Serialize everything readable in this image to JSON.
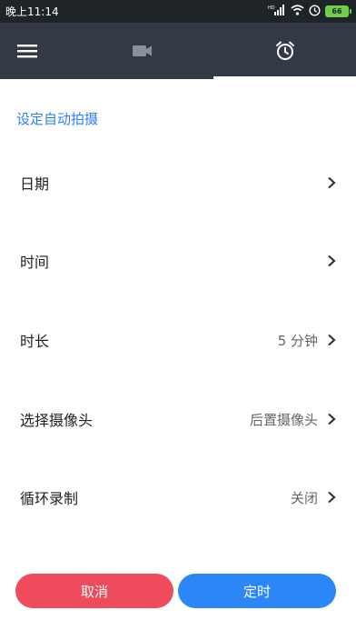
{
  "status_bar": {
    "time": "晚上11:14",
    "network": "HD",
    "battery": "66"
  },
  "toolbar": {
    "menu_icon": "menu-icon",
    "tabs": [
      {
        "icon": "video-camera-icon",
        "selected": false
      },
      {
        "icon": "alarm-clock-icon",
        "selected": true
      }
    ]
  },
  "main": {
    "section_title": "设定自动拍摄",
    "rows": [
      {
        "label": "日期",
        "value": ""
      },
      {
        "label": "时间",
        "value": ""
      },
      {
        "label": "时长",
        "value": "5 分钟"
      },
      {
        "label": "选择摄像头",
        "value": "后置摄像头"
      },
      {
        "label": "循环录制",
        "value": "关闭"
      }
    ]
  },
  "footer": {
    "cancel_label": "取消",
    "confirm_label": "定时"
  },
  "colors": {
    "toolbar_bg": "#343a45",
    "accent_blue": "#2d86f6",
    "cancel_red": "#ee4b5c"
  }
}
